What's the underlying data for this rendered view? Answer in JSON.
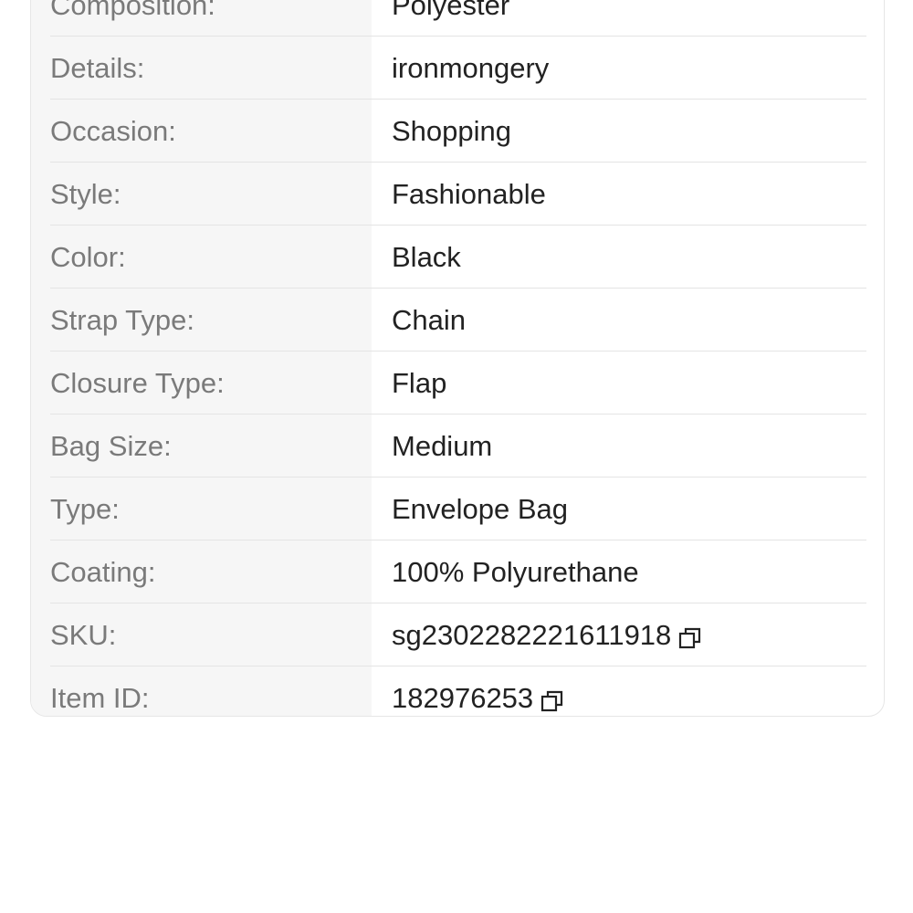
{
  "specs": {
    "rows": [
      {
        "label": "Composition:",
        "value": "Polyester"
      },
      {
        "label": "Details:",
        "value": "ironmongery"
      },
      {
        "label": "Occasion:",
        "value": "Shopping"
      },
      {
        "label": "Style:",
        "value": "Fashionable"
      },
      {
        "label": "Color:",
        "value": "Black"
      },
      {
        "label": "Strap Type:",
        "value": "Chain"
      },
      {
        "label": "Closure Type:",
        "value": "Flap"
      },
      {
        "label": "Bag Size:",
        "value": "Medium"
      },
      {
        "label": "Type:",
        "value": "Envelope Bag"
      },
      {
        "label": "Coating:",
        "value": "100% Polyurethane"
      },
      {
        "label": "SKU:",
        "value": "sg2302282221611918",
        "copy_icon": "copy-icon"
      },
      {
        "label": "Item ID:",
        "value": "182976253",
        "copy_icon": "copy-icon"
      }
    ]
  },
  "colors": {
    "label_text": "#7a7a7a",
    "value_text": "#222222",
    "label_column_bg": "#f6f6f6",
    "divider": "#e4e4e4"
  }
}
